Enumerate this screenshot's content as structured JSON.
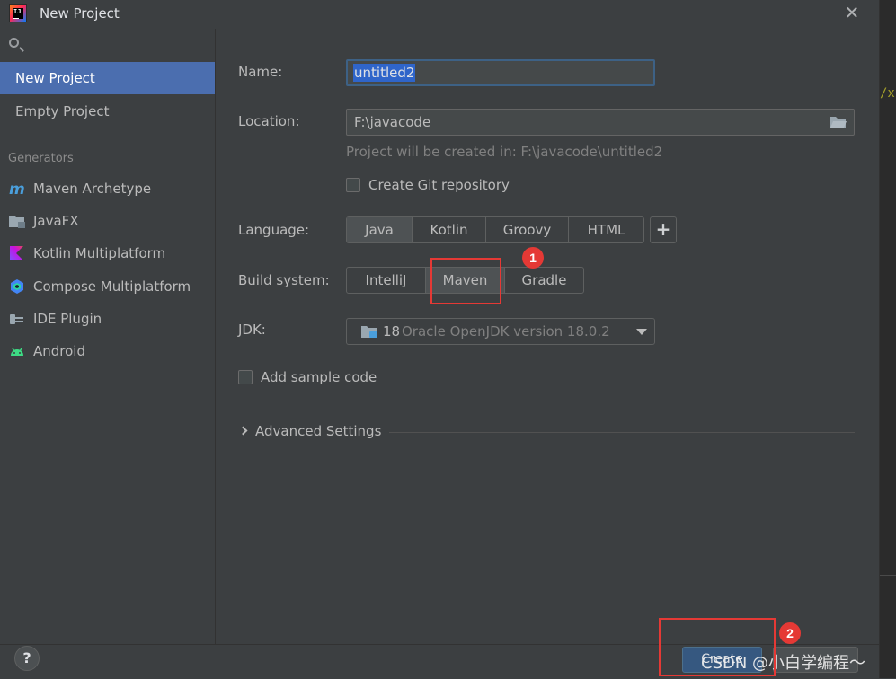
{
  "window": {
    "title": "New Project",
    "close_glyph": "✕"
  },
  "sidebar": {
    "top_items": [
      {
        "label": "New Project",
        "selected": true
      },
      {
        "label": "Empty Project",
        "selected": false
      }
    ],
    "generators_header": "Generators",
    "generators": [
      {
        "label": "Maven Archetype",
        "icon": "maven-icon"
      },
      {
        "label": "JavaFX",
        "icon": "javafx-folder-icon"
      },
      {
        "label": "Kotlin Multiplatform",
        "icon": "kotlin-icon"
      },
      {
        "label": "Compose Multiplatform",
        "icon": "compose-icon"
      },
      {
        "label": "IDE Plugin",
        "icon": "plugin-icon"
      },
      {
        "label": "Android",
        "icon": "android-icon"
      }
    ]
  },
  "form": {
    "name_label": "Name:",
    "name_value": "untitled2",
    "location_label": "Location:",
    "location_value": "F:\\javacode",
    "hint": "Project will be created in: F:\\javacode\\untitled2",
    "git_label": "Create Git repository",
    "git_checked": false,
    "language_label": "Language:",
    "languages": [
      "Java",
      "Kotlin",
      "Groovy",
      "HTML"
    ],
    "language_selected": "Java",
    "add_glyph": "+",
    "build_label": "Build system:",
    "build_systems": [
      "IntelliJ",
      "Maven",
      "Gradle"
    ],
    "build_selected": "Maven",
    "jdk_label": "JDK:",
    "jdk_version": "18",
    "jdk_desc": "Oracle OpenJDK version 18.0.2",
    "sample_label": "Add sample code",
    "sample_checked": false,
    "advanced_label": "Advanced Settings"
  },
  "footer": {
    "help_glyph": "?",
    "create_label": "Create"
  },
  "annotations": {
    "badge1": "1",
    "badge2": "2"
  },
  "watermark": "CSDN @小白学编程～",
  "editor_fragment": "/xs",
  "colors": {
    "accent": "#4b6eaf",
    "create": "#365880",
    "annotation_red": "#e53935"
  }
}
